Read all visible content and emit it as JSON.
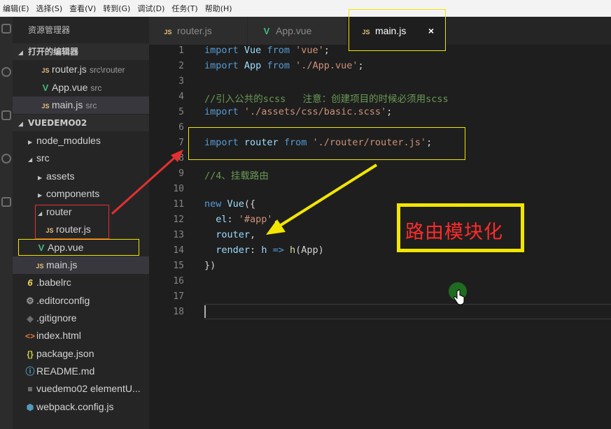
{
  "menu": [
    "编辑(E)",
    "选择(S)",
    "查看(V)",
    "转到(G)",
    "调试(D)",
    "任务(T)",
    "帮助(H)"
  ],
  "sidebar": {
    "title": "资源管理器",
    "open_editors": {
      "label": "打开的编辑器",
      "items": [
        {
          "name": "router.js",
          "desc": "src\\router",
          "icon": "js-icon"
        },
        {
          "name": "App.vue",
          "desc": "src",
          "icon": "vue-icon"
        },
        {
          "name": "main.js",
          "desc": "src",
          "icon": "js-icon"
        }
      ]
    },
    "project": {
      "label": "VUEDEMO02",
      "tree": [
        {
          "name": "node_modules",
          "type": "folder"
        },
        {
          "name": "src",
          "type": "folder-open"
        },
        {
          "name": "assets",
          "type": "folder"
        },
        {
          "name": "components",
          "type": "folder"
        },
        {
          "name": "router",
          "type": "folder-open"
        },
        {
          "name": "router.js",
          "type": "js"
        },
        {
          "name": "App.vue",
          "type": "vue"
        },
        {
          "name": "main.js",
          "type": "js"
        },
        {
          "name": ".babelrc",
          "type": "babel"
        },
        {
          "name": ".editorconfig",
          "type": "gear"
        },
        {
          "name": ".gitignore",
          "type": "git"
        },
        {
          "name": "index.html",
          "type": "html"
        },
        {
          "name": "package.json",
          "type": "json"
        },
        {
          "name": "README.md",
          "type": "info"
        },
        {
          "name": "vuedemo02 elementU...",
          "type": "lines"
        },
        {
          "name": "webpack.config.js",
          "type": "cube"
        }
      ]
    }
  },
  "tabs": [
    {
      "label": "router.js",
      "icon": "js-icon"
    },
    {
      "label": "App.vue",
      "icon": "vue-icon"
    },
    {
      "label": "main.js",
      "icon": "js-icon",
      "active": true
    }
  ],
  "icon_text": {
    "js": "JS",
    "vue": "V",
    "babel": "6",
    "gear": "⚙",
    "git": "◆",
    "html": "<>",
    "json": "{}",
    "info": "ⓘ",
    "lines": "≡",
    "cube": "⬢",
    "close": "×"
  },
  "editor": {
    "line_numbers": [
      "1",
      "2",
      "3",
      "4",
      "5",
      "6",
      "7",
      "8",
      "9",
      "10",
      "11",
      "12",
      "13",
      "14",
      "15",
      "16",
      "17",
      "18"
    ],
    "lines": {
      "l1": {
        "a": "import",
        "b": "Vue",
        "c": "from",
        "d": "'vue'",
        "e": ";"
      },
      "l2": {
        "a": "import",
        "b": "App",
        "c": "from",
        "d": "'./App.vue'",
        "e": ";"
      },
      "l4": "//引入公共的scss   注意：创建项目的时候必须用scss",
      "l5": {
        "a": "import",
        "d": "'./assets/css/basic.scss'",
        "e": ";"
      },
      "l7": {
        "a": "import",
        "b": "router",
        "c": "from",
        "d": "'./router/router.js'",
        "e": ";"
      },
      "l9": "//4、挂载路由",
      "l11": {
        "a": "new",
        "b": "Vue",
        "e": "({"
      },
      "l12": {
        "a": "el",
        "e": ": ",
        "d": "'#app'",
        "f": ","
      },
      "l13": {
        "a": "router",
        "e": ","
      },
      "l14": {
        "a": "render",
        "e": ": ",
        "b": "h",
        "g": "=>",
        "c": "h",
        "h": "(App)"
      },
      "l15": "})"
    }
  },
  "callout": "路由模块化",
  "colors": {
    "keyword": "#569cd6",
    "string": "#ce9178",
    "comment": "#6a9955",
    "annotation_red": "#e53030",
    "annotation_yellow": "#f2e600"
  }
}
